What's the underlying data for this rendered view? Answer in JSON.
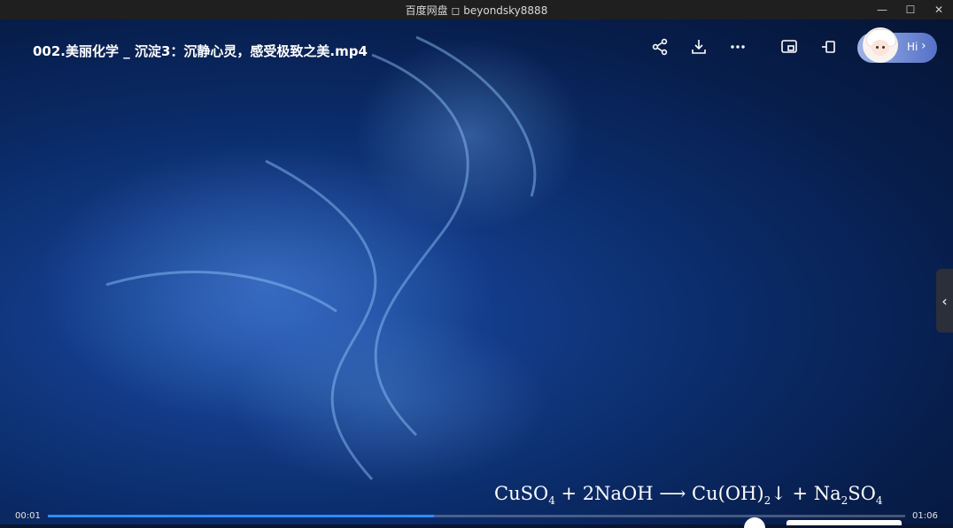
{
  "window": {
    "title": "百度网盘 ◻ beyondsky8888",
    "controls": [
      "—",
      "☐",
      "✕"
    ]
  },
  "player": {
    "file_title": "002.美丽化学 _ 沉淀3：沉静心灵，感受极致之美.mp4",
    "icons": [
      "share-icon",
      "download-icon",
      "more-icon",
      "picture-in-picture-icon",
      "pin-icon"
    ],
    "assistant_label": "Hi",
    "assistant_arrow": "›",
    "side_handle_label": "‹",
    "current_time": "00:01",
    "total_time": "01:06",
    "progress_fraction": 0.45,
    "progress_color": "#2f8cff"
  },
  "formula": {
    "r1": "CuSO",
    "r1_sub": "4",
    "plus1": " + 2NaOH ",
    "arrow": "⟶",
    "p1": " Cu(OH)",
    "p1_sub": "2",
    "down": "↓",
    "plus2": " + Na",
    "p2_sub": "2",
    "p2b": "SO",
    "p2_sub2": "4"
  }
}
